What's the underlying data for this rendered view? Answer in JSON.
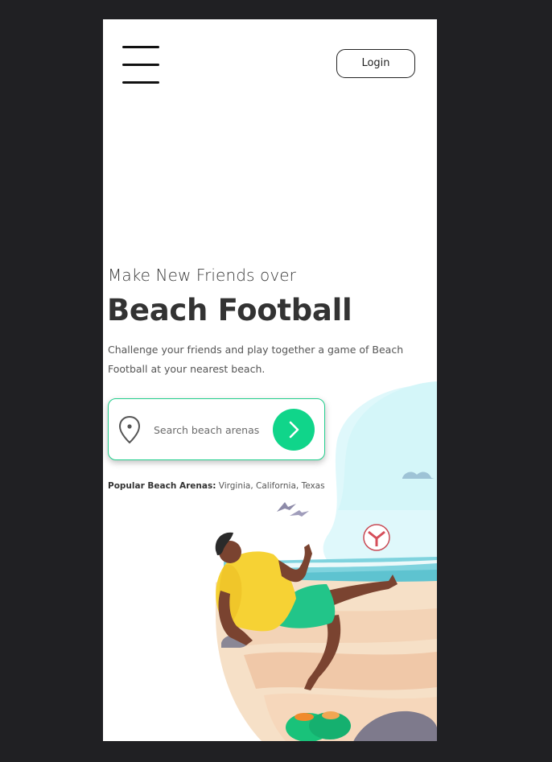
{
  "header": {
    "login_label": "Login"
  },
  "hero": {
    "subtitle": "Make New Friends over",
    "title": "Beach Football",
    "description": "Challenge your friends and play together a game of Beach Football at your nearest beach."
  },
  "search": {
    "placeholder": "Search beach arenas",
    "location_icon": "map-pin-icon",
    "submit_icon": "chevron-right-icon"
  },
  "popular": {
    "label": "Popular Beach Arenas:",
    "locations": "Virginia, California, Texas"
  },
  "colors": {
    "accent": "#10d58a",
    "background": "#202023",
    "text": "#333333"
  }
}
